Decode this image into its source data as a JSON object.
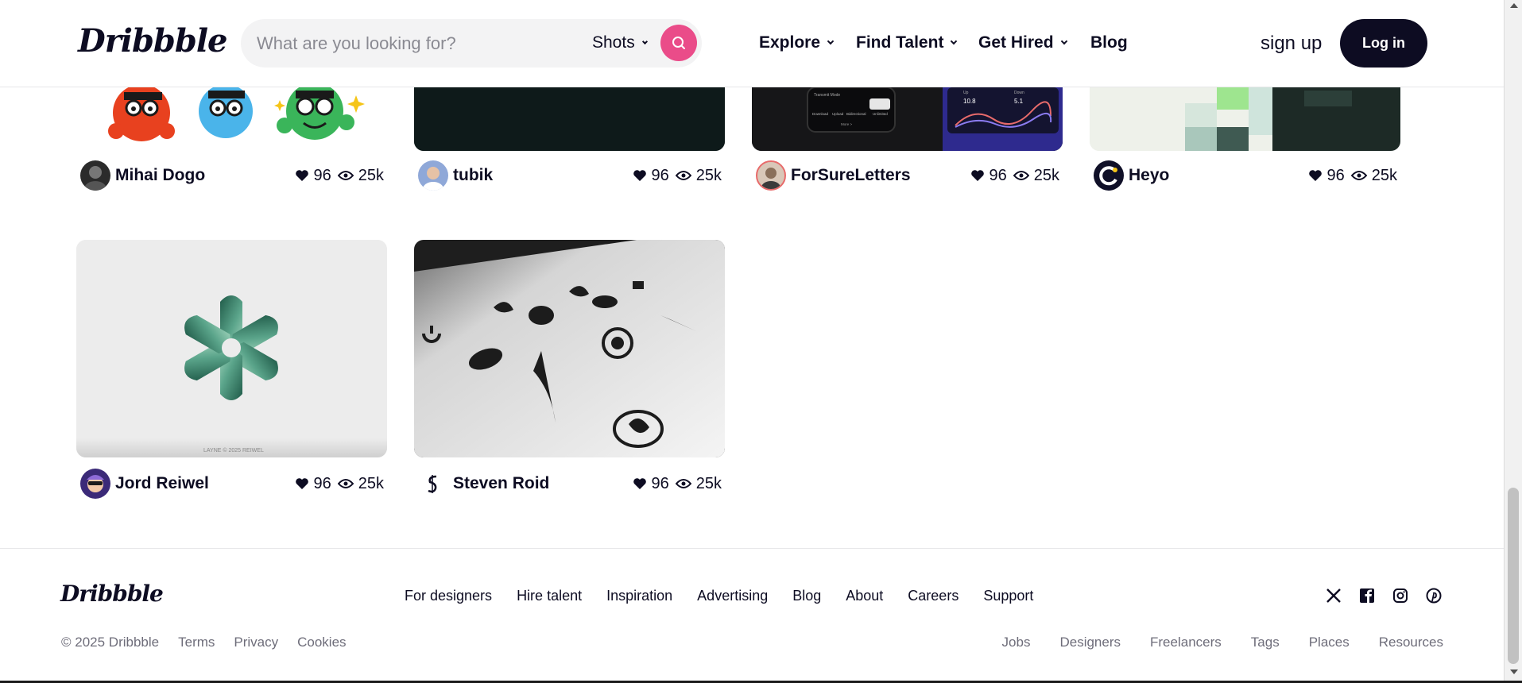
{
  "header": {
    "logo": "Dribbble",
    "search": {
      "placeholder": "What are you looking for?",
      "value": "",
      "scope": "Shots"
    },
    "nav": [
      {
        "label": "Explore",
        "has_caret": true
      },
      {
        "label": "Find Talent",
        "has_caret": true
      },
      {
        "label": "Get Hired",
        "has_caret": true
      },
      {
        "label": "Blog",
        "has_caret": false
      }
    ],
    "signup_label": "sign up",
    "login_label": "Log in"
  },
  "shots": [
    {
      "author": "Mihai Dogo",
      "likes": "96",
      "views": "25k"
    },
    {
      "author": "tubik",
      "likes": "96",
      "views": "25k"
    },
    {
      "author": "ForSureLetters",
      "likes": "96",
      "views": "25k"
    },
    {
      "author": "Heyo",
      "likes": "96",
      "views": "25k"
    },
    {
      "author": "Jord Reiwel",
      "likes": "96",
      "views": "25k"
    },
    {
      "author": "Steven Roid",
      "likes": "96",
      "views": "25k"
    }
  ],
  "shot_thumb_text": {
    "forsure_mini": [
      "Transmit Mode",
      "Download",
      "Upload",
      "Bidirectional",
      "Unlimited",
      "More >",
      "Up",
      "10.8",
      "Down",
      "5.1"
    ],
    "jord_caption": "LAYNE  © 2025 REIWEL"
  },
  "footer": {
    "logo": "Dribbble",
    "links": [
      "For designers",
      "Hire talent",
      "Inspiration",
      "Advertising",
      "Blog",
      "About",
      "Careers",
      "Support"
    ],
    "social": [
      "x-icon",
      "facebook-icon",
      "instagram-icon",
      "pinterest-icon"
    ],
    "copyright": "© 2025 Dribbble",
    "legal": [
      "Terms",
      "Privacy",
      "Cookies"
    ],
    "directory": [
      "Jobs",
      "Designers",
      "Freelancers",
      "Tags",
      "Places",
      "Resources"
    ]
  },
  "colors": {
    "brand_pink": "#ea4c89",
    "text_dark": "#0d0c22",
    "muted": "#6e6d7a"
  }
}
